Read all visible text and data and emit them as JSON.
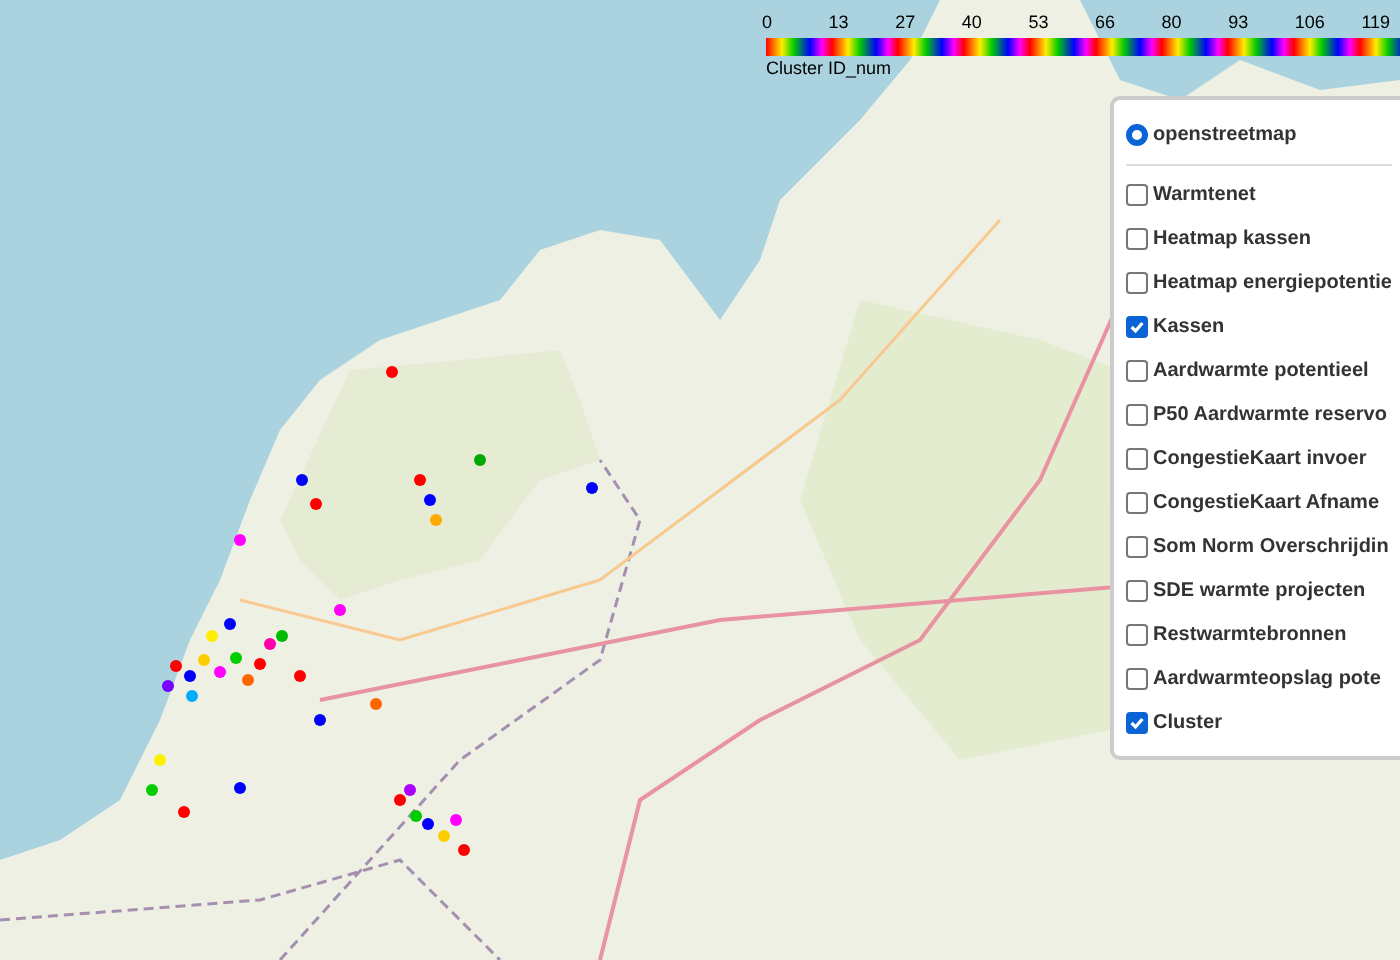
{
  "legend": {
    "ticks": [
      "0",
      "13",
      "27",
      "40",
      "53",
      "66",
      "80",
      "93",
      "106",
      "119"
    ],
    "caption": "Cluster ID_num"
  },
  "layer_control": {
    "base_layers": [
      {
        "label": "openstreetmap",
        "selected": true
      }
    ],
    "overlays": [
      {
        "label": "Warmtenet",
        "checked": false
      },
      {
        "label": "Heatmap kassen",
        "checked": false
      },
      {
        "label": "Heatmap energiepotentie",
        "checked": false
      },
      {
        "label": "Kassen",
        "checked": true
      },
      {
        "label": "Aardwarmte potentieel",
        "checked": false
      },
      {
        "label": "P50 Aardwarmte reservo",
        "checked": false
      },
      {
        "label": "CongestieKaart invoer",
        "checked": false
      },
      {
        "label": "CongestieKaart Afname",
        "checked": false
      },
      {
        "label": "Som Norm Overschrijdin",
        "checked": false
      },
      {
        "label": "SDE warmte projecten",
        "checked": false
      },
      {
        "label": "Restwarmtebronnen",
        "checked": false
      },
      {
        "label": "Aardwarmteopslag pote",
        "checked": false
      },
      {
        "label": "Cluster",
        "checked": true
      }
    ]
  }
}
